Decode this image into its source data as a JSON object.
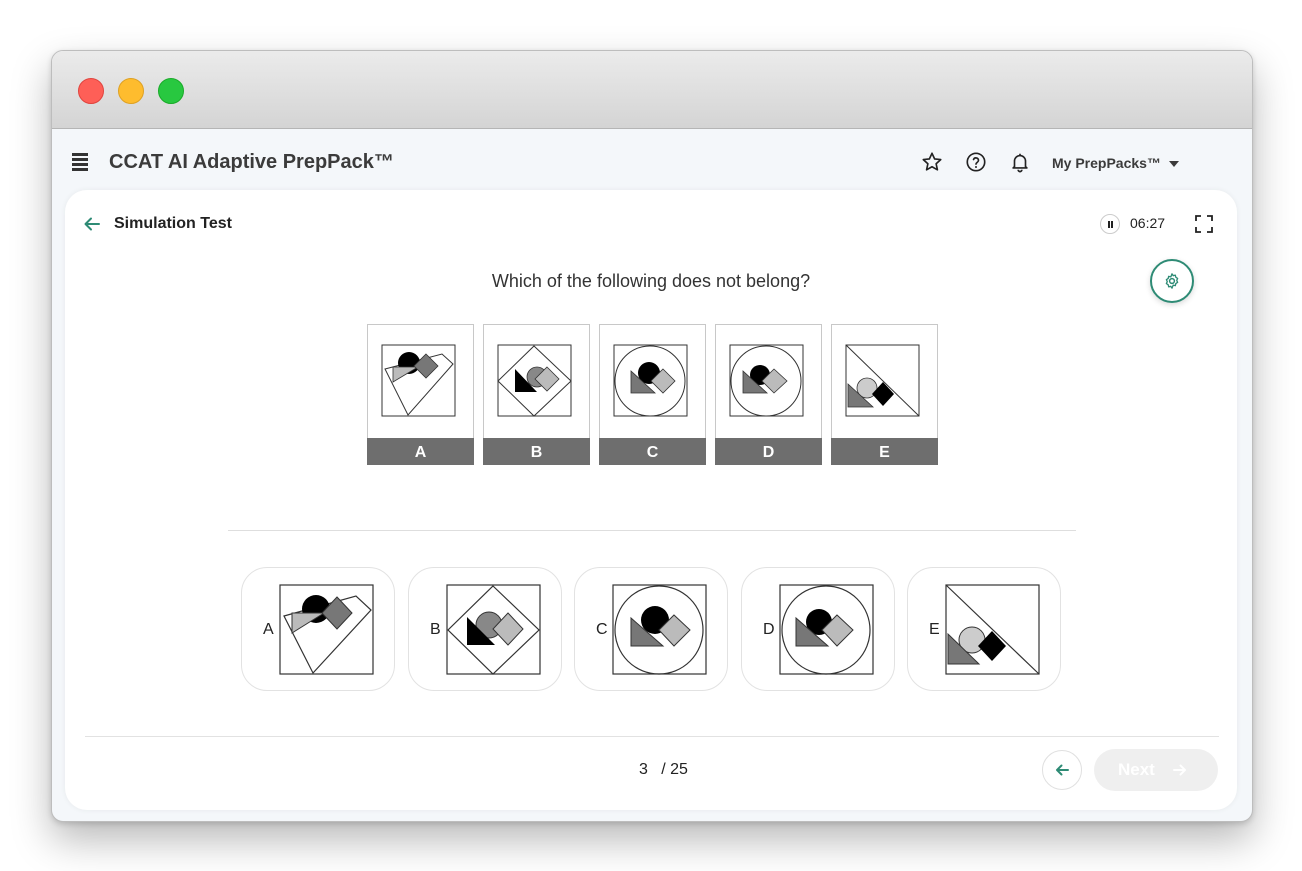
{
  "header": {
    "app_title": "CCAT AI Adaptive PrepPack™",
    "my_preppacks": "My PrepPacks™"
  },
  "test": {
    "title": "Simulation Test",
    "timer": "06:27"
  },
  "question": {
    "text": "Which of the following does not belong?",
    "figures": [
      "A",
      "B",
      "C",
      "D",
      "E"
    ]
  },
  "options": [
    "A",
    "B",
    "C",
    "D",
    "E"
  ],
  "pagination": {
    "current": "3",
    "total": "/ 25"
  },
  "footer": {
    "next_label": "Next"
  },
  "colors": {
    "accent": "#2e8b75",
    "label_bg": "#6e6e6e",
    "next_disabled": "#efefef"
  },
  "icons": [
    "menu-icon",
    "star-icon",
    "help-icon",
    "bell-icon",
    "chevron-down-icon",
    "arrow-left-icon",
    "pause-icon",
    "fullscreen-icon",
    "settings-gear-icon",
    "arrow-right-icon"
  ]
}
